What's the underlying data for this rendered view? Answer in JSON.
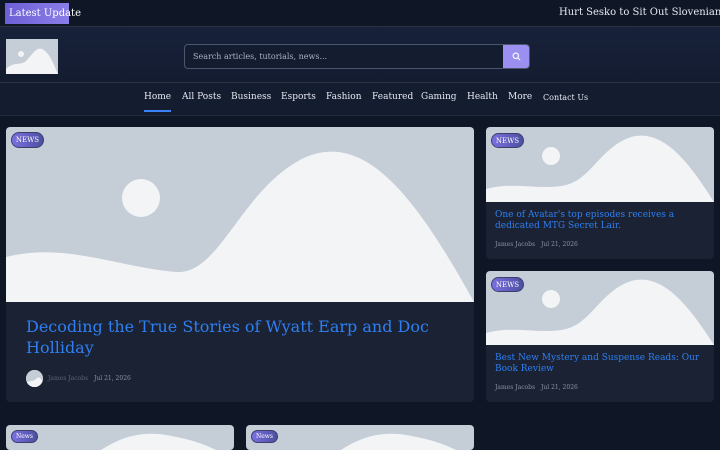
{
  "ticker": {
    "label": "Latest  Update",
    "headline": "Hurt Sesko to Sit Out Slovenian Nations"
  },
  "header": {
    "logo_icon": "image-placeholder-icon",
    "search": {
      "placeholder": "Search articles, tutorials, news...",
      "value": ""
    },
    "search_icon": "search-icon"
  },
  "nav": {
    "items": [
      {
        "label": "Home",
        "active": true
      },
      {
        "label": "All Posts"
      },
      {
        "label": "Business"
      },
      {
        "label": "Esports"
      },
      {
        "label": "Fashion"
      },
      {
        "label": "Featured"
      },
      {
        "label": "Gaming"
      },
      {
        "label": "Health"
      },
      {
        "label": "More"
      },
      {
        "label": "Contact Us"
      }
    ]
  },
  "featured": {
    "badge": "NEWS",
    "title": "Decoding the True Stories of Wyatt Earp and Doc Holliday",
    "author": "James Jacobs",
    "date": "Jul 21, 2026"
  },
  "side_cards": [
    {
      "badge": "NEWS",
      "title": "One of Avatar's top episodes receives a dedicated MTG Secret Lair.",
      "author": "James Jacobs",
      "date": "Jul 21, 2026"
    },
    {
      "badge": "NEWS",
      "title": "Best New Mystery and Suspense Reads: Our Book Review",
      "author": "James Jacobs",
      "date": "Jul 21, 2026"
    }
  ],
  "bottom_cards": [
    {
      "badge": "News"
    },
    {
      "badge": "News"
    }
  ],
  "colors": {
    "background": "#0f1626",
    "card": "#1a2234",
    "accent": "#2f7ff0",
    "badge": "#7b6fe0",
    "search_button": "#9b8ff0"
  }
}
